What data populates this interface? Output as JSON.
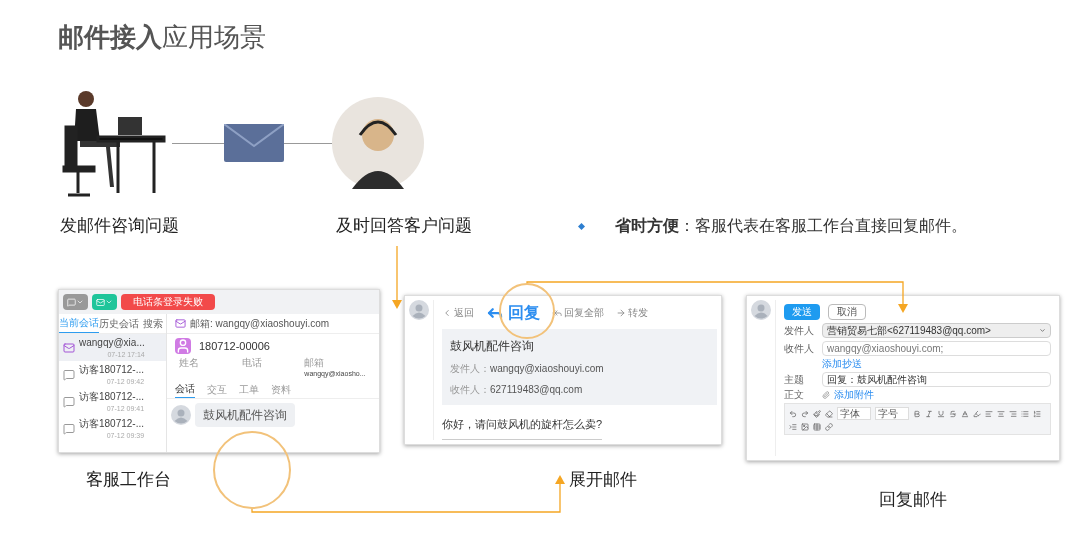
{
  "title": "**邮件接入**应用场景",
  "flow": {
    "customer_label": "发邮件咨询问题",
    "agent_label": "及时回答客户问题"
  },
  "highlight": {
    "text": "**省时方便**：客服代表在客服工作台直接回复邮件。"
  },
  "workbench": {
    "caption": "客服工作台",
    "alert": "电话条登录失败",
    "session_tabs": [
      {
        "label": "当前会话",
        "selected": true
      },
      {
        "label": "历史会话",
        "selected": false
      },
      {
        "label": "搜索",
        "selected": false
      }
    ],
    "sessions": [
      {
        "kind": "email",
        "name": "wangqy@xia...",
        "time": "07-12 17:14",
        "selected": true
      },
      {
        "kind": "visitor",
        "name": "访客180712-...",
        "time": "07-12 09:42",
        "selected": false
      },
      {
        "kind": "visitor",
        "name": "访客180712-...",
        "time": "07-12 09:41",
        "selected": false
      },
      {
        "kind": "visitor",
        "name": "访客180712-...",
        "time": "07-12 09:39",
        "selected": false
      }
    ],
    "email_line": "邮箱: wangqy@xiaoshouyi.com",
    "contact_id": "180712-00006",
    "fields": [
      {
        "label": "姓名"
      },
      {
        "label": "电话"
      },
      {
        "label": "邮箱",
        "value": "wangqy@xiaosho..."
      }
    ],
    "detail_tabs": [
      {
        "label": "会话",
        "selected": true
      },
      {
        "label": "交互",
        "selected": false
      },
      {
        "label": "工单",
        "selected": false
      },
      {
        "label": "资料",
        "selected": false
      }
    ],
    "message": "鼓风机配件咨询"
  },
  "expanded_mail": {
    "caption": "展开邮件",
    "actions": [
      {
        "kind": "back",
        "label": "返回"
      },
      {
        "kind": "reply",
        "label": "回复"
      },
      {
        "kind": "reply_all",
        "label": "回复全部"
      },
      {
        "kind": "forward",
        "label": "转发"
      }
    ],
    "subject": "鼓风机配件咨询",
    "from_label": "发件人：",
    "from_value": "wangqy@xiaoshouyi.com",
    "to_label": "收件人：",
    "to_value": "627119483@qq.com",
    "body": "你好，请问鼓风机的旋杆怎么卖?"
  },
  "reply_mail": {
    "caption": "回复邮件",
    "buttons": [
      {
        "kind": "primary",
        "label": "发送"
      },
      {
        "kind": "secondary",
        "label": "取消"
      }
    ],
    "sender_label": "发件人",
    "sender_value": "营销贸易七部<627119483@qq.com>",
    "to_label": "收件人",
    "to_value": "wangqy@xiaoshouyi.com;",
    "cc_link": "添加抄送",
    "subject_label": "主题",
    "subject_value": "回复：鼓风机配件咨询",
    "body_label": "正文",
    "attach_link": "添加附件",
    "font_select": "字体",
    "size_select": "字号"
  }
}
